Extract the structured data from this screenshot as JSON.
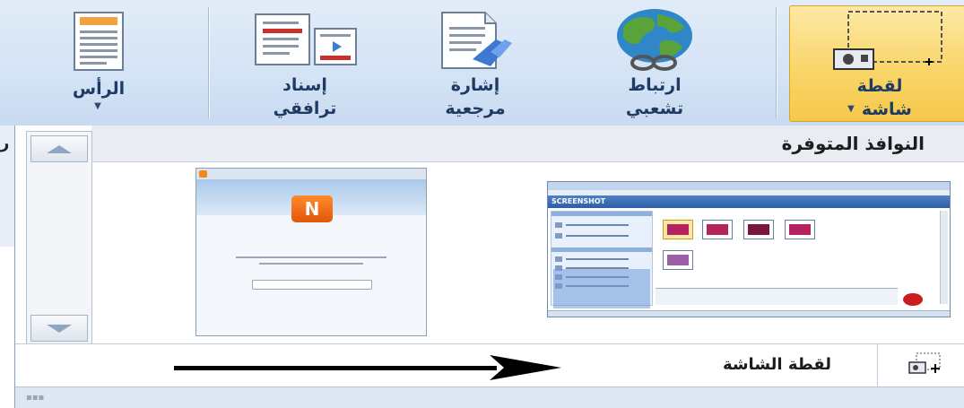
{
  "ribbon": {
    "header": {
      "label": "الرأس",
      "arrow": "▼"
    },
    "cross_reference": {
      "label_line1": "إسناد",
      "label_line2": "ترافقي"
    },
    "bookmark": {
      "label_line1": "إشارة",
      "label_line2": "مرجعية"
    },
    "hyperlink": {
      "label_line1": "ارتباط",
      "label_line2": "تشعبي"
    },
    "screenshot": {
      "label_line1": "لقطة",
      "label_line2": "شاشة",
      "arrow": "▼"
    },
    "left_edge_char": "ر"
  },
  "gallery": {
    "title": "النوافذ المتوفرة",
    "scroll_up_icon": "triangle-up-icon",
    "scroll_down_icon": "triangle-down-icon",
    "thumbnails": [
      {
        "name": "nimbuzz-window",
        "logo_text": "N"
      },
      {
        "name": "word-screenshot-window",
        "banner_text": "SCREENSHOT"
      }
    ],
    "footer": {
      "label": "لقطة الشاشة",
      "icon": "screen-clipping-icon"
    }
  }
}
